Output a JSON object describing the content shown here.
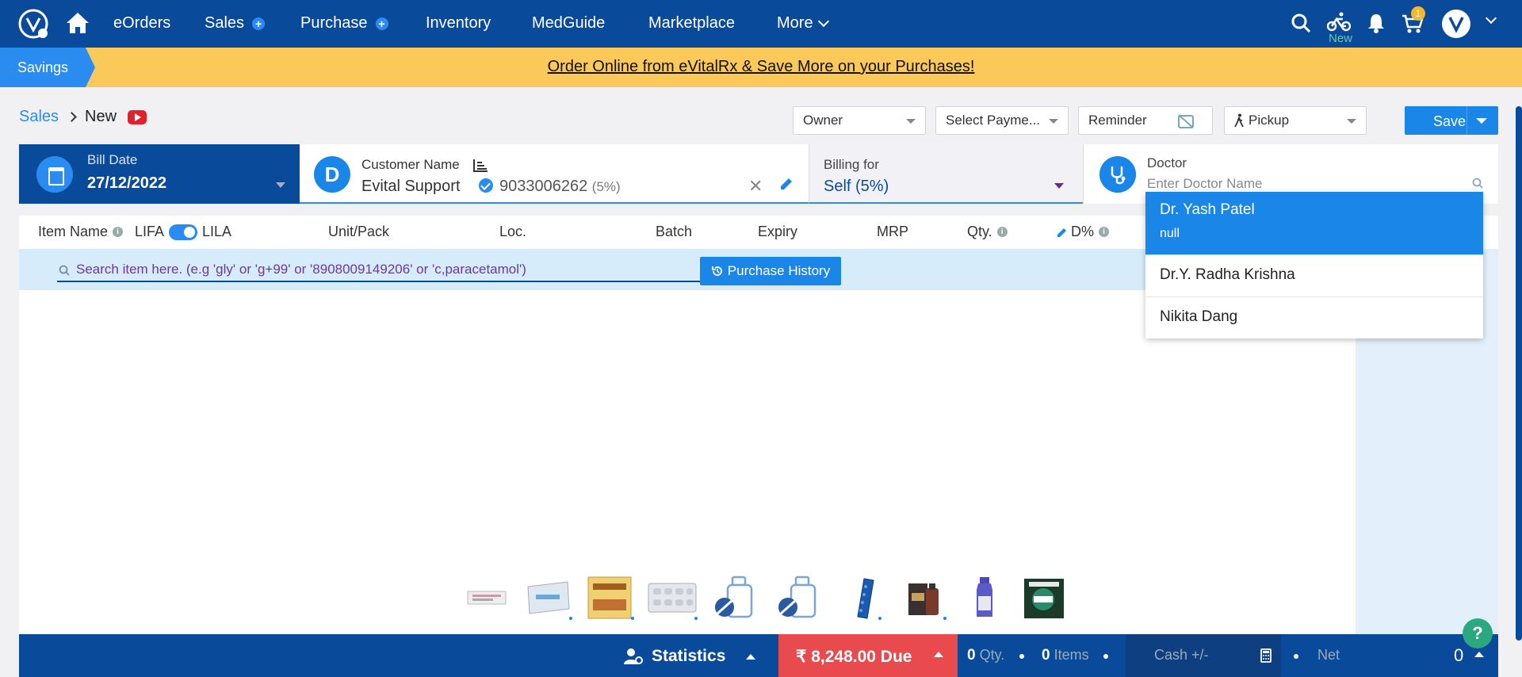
{
  "nav": {
    "items": [
      {
        "label": "eOrders",
        "plus": false
      },
      {
        "label": "Sales",
        "plus": true
      },
      {
        "label": "Purchase",
        "plus": true
      },
      {
        "label": "Inventory",
        "plus": false
      },
      {
        "label": "MedGuide",
        "plus": false
      },
      {
        "label": "Marketplace",
        "plus": false
      }
    ],
    "more_label": "More",
    "delivery_tag": "New",
    "cart_count": "1",
    "icons": [
      "logo-icon",
      "home-icon",
      "search-icon",
      "bike-icon",
      "bell-icon",
      "cart-icon",
      "avatar-icon"
    ]
  },
  "savings": {
    "tag": "Savings",
    "message": "Order Online from eVitalRx & Save More on your Purchases!"
  },
  "breadcrumb": {
    "root": "Sales",
    "current": "New"
  },
  "toolbar": {
    "owner": "Owner",
    "payment": "Select Payme...",
    "reminder": "Reminder",
    "pickup": "Pickup",
    "save": "Save"
  },
  "bill": {
    "label": "Bill Date",
    "date": "27/12/2022"
  },
  "customer": {
    "avatar_letter": "D",
    "label": "Customer Name",
    "name": "Evital Support",
    "phone": "9033006262",
    "discount": "(5%)"
  },
  "billing": {
    "label": "Billing for",
    "value": "Self (5%)"
  },
  "doctor": {
    "label": "Doctor",
    "placeholder": "Enter Doctor Name",
    "options": [
      {
        "name": "Dr. Yash Patel",
        "sub": "null",
        "active": true
      },
      {
        "name": "Dr.Y. Radha Krishna",
        "sub": "",
        "active": false
      },
      {
        "name": "Nikita Dang",
        "sub": "",
        "active": false
      }
    ]
  },
  "columns": {
    "item_name": "Item Name",
    "lifa": "LIFA",
    "lila": "LILA",
    "unit_pack": "Unit/Pack",
    "loc": "Loc.",
    "batch": "Batch",
    "expiry": "Expiry",
    "mrp": "MRP",
    "qty": "Qty.",
    "disc": "D%"
  },
  "search": {
    "placeholder": "Search item here. (e.g 'gly' or 'g+99' or '8908009149206' or 'c,paracetamol')",
    "history_button": "Purchase History"
  },
  "bottom": {
    "statistics": "Statistics",
    "due_amount": "₹ 8,248.00 Due",
    "qty_value": "0",
    "qty_label": "Qty.",
    "items_value": "0",
    "items_label": "Items",
    "cash_placeholder": "Cash +/-",
    "net_label": "Net",
    "net_value": "0"
  },
  "help": "?"
}
